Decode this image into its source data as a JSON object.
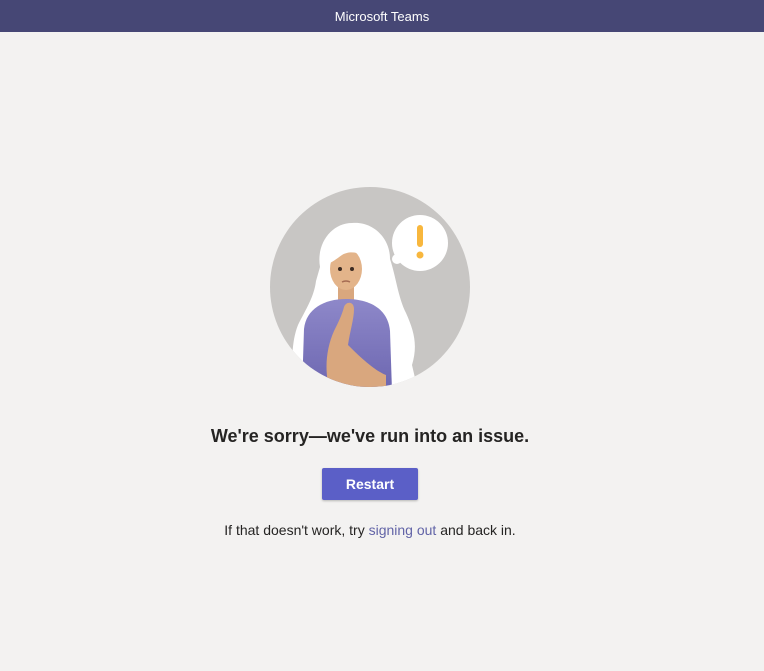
{
  "window": {
    "title": "Microsoft Teams"
  },
  "error": {
    "headline": "We're sorry—we've run into an issue.",
    "restart_label": "Restart",
    "hint_before": "If that doesn't work, try ",
    "hint_link": "signing out",
    "hint_after": " and back in."
  },
  "colors": {
    "titlebar": "#464775",
    "background": "#f3f2f1",
    "button": "#5b5fc7",
    "link": "#6264a7",
    "warning": "#f8b73d"
  },
  "icons": {
    "illustration": "confused-person-illustration",
    "thought": "exclamation-thought-bubble-icon"
  }
}
